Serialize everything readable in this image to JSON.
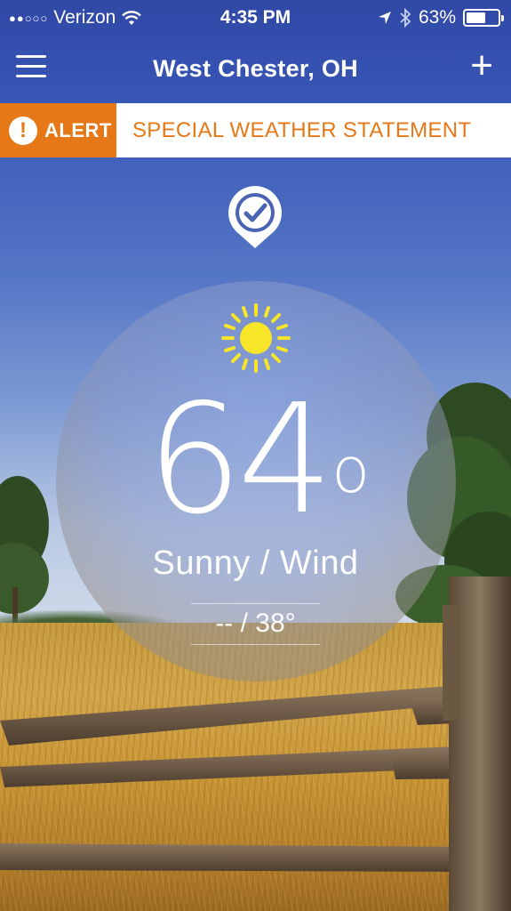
{
  "status_bar": {
    "carrier": "Verizon",
    "signal": "●●○○○",
    "time": "4:35 PM",
    "battery": "63%",
    "battery_level": 0.63,
    "icons": [
      "wifi-icon",
      "location-arrow-icon",
      "bluetooth-icon",
      "battery-icon"
    ]
  },
  "nav": {
    "title": "West Chester, OH",
    "menu_icon": "hamburger-menu-icon",
    "add_label": "+"
  },
  "alert": {
    "tag": "ALERT",
    "icon_glyph": "!",
    "message": "SPECIAL WEATHER STATEMENT",
    "accent_color": "#e67817"
  },
  "weather": {
    "location_icon": "location-check-icon",
    "condition_icon": "sun-icon",
    "temperature": "64",
    "degree_symbol": "o",
    "condition": "Sunny / Wind",
    "hi_lo": "-- / 38°"
  }
}
